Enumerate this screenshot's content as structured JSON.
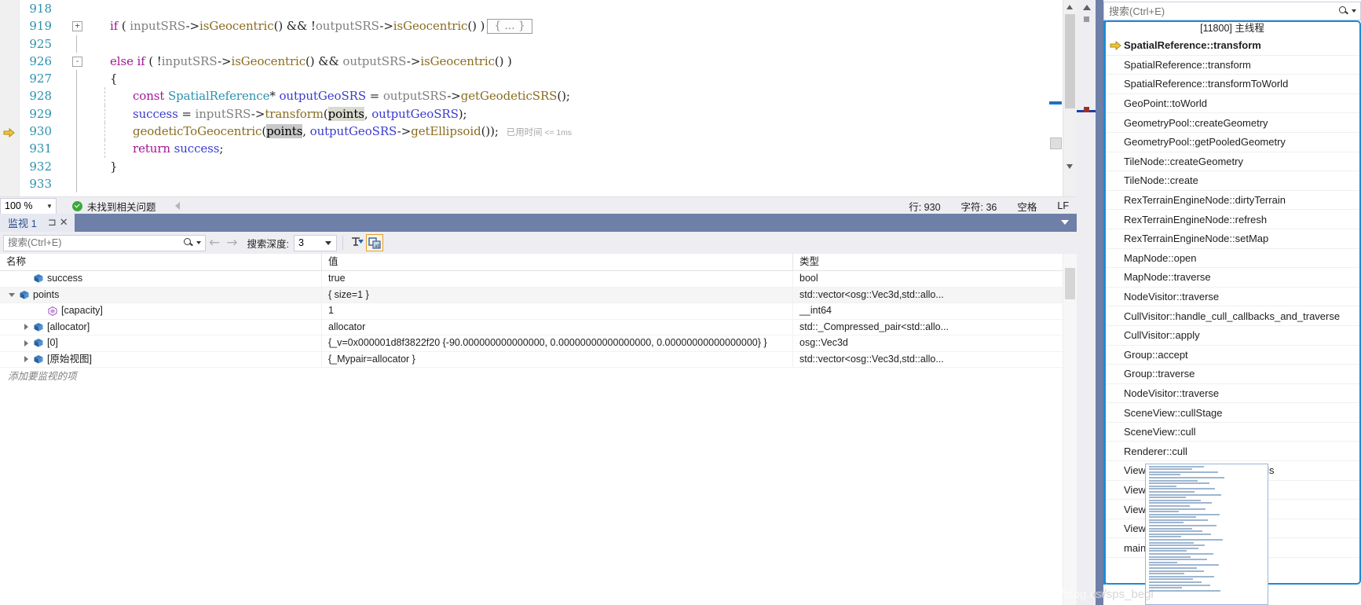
{
  "editor": {
    "lines": [
      {
        "num": "918",
        "fold": "",
        "indent": 0,
        "tokens": []
      },
      {
        "num": "919",
        "fold": "+",
        "indent": 0,
        "tokens": [
          {
            "t": "kw",
            "s": "if"
          },
          {
            "t": "pln",
            "s": " ( "
          },
          {
            "t": "gray",
            "s": "inputSRS"
          },
          {
            "t": "pln",
            "s": "->"
          },
          {
            "t": "fn",
            "s": "isGeocentric"
          },
          {
            "t": "pln",
            "s": "() && !"
          },
          {
            "t": "gray",
            "s": "outputSRS"
          },
          {
            "t": "pln",
            "s": "->"
          },
          {
            "t": "fn",
            "s": "isGeocentric"
          },
          {
            "t": "pln",
            "s": "() )"
          },
          {
            "t": "collapsed",
            "s": "{ ... }"
          }
        ]
      },
      {
        "num": "925",
        "fold": "",
        "indent": 0,
        "tokens": []
      },
      {
        "num": "926",
        "fold": "-",
        "indent": 0,
        "tokens": [
          {
            "t": "kw",
            "s": "else"
          },
          {
            "t": "pln",
            "s": " "
          },
          {
            "t": "kw",
            "s": "if"
          },
          {
            "t": "pln",
            "s": " ( !"
          },
          {
            "t": "gray",
            "s": "inputSRS"
          },
          {
            "t": "pln",
            "s": "->"
          },
          {
            "t": "fn",
            "s": "isGeocentric"
          },
          {
            "t": "pln",
            "s": "() && "
          },
          {
            "t": "gray",
            "s": "outputSRS"
          },
          {
            "t": "pln",
            "s": "->"
          },
          {
            "t": "fn",
            "s": "isGeocentric"
          },
          {
            "t": "pln",
            "s": "() )"
          }
        ]
      },
      {
        "num": "927",
        "fold": "",
        "indent": 0,
        "tokens": [
          {
            "t": "pln",
            "s": "{"
          }
        ]
      },
      {
        "num": "928",
        "fold": "",
        "indent": 1,
        "tokens": [
          {
            "t": "kw",
            "s": "const"
          },
          {
            "t": "pln",
            "s": " "
          },
          {
            "t": "typ",
            "s": "SpatialReference"
          },
          {
            "t": "pln",
            "s": "* "
          },
          {
            "t": "var",
            "s": "outputGeoSRS"
          },
          {
            "t": "pln",
            "s": " = "
          },
          {
            "t": "gray",
            "s": "outputSRS"
          },
          {
            "t": "pln",
            "s": "->"
          },
          {
            "t": "fn",
            "s": "getGeodeticSRS"
          },
          {
            "t": "pln",
            "s": "();"
          }
        ]
      },
      {
        "num": "929",
        "fold": "",
        "indent": 1,
        "tokens": [
          {
            "t": "var",
            "s": "success"
          },
          {
            "t": "pln",
            "s": " = "
          },
          {
            "t": "gray",
            "s": "inputSRS"
          },
          {
            "t": "pln",
            "s": "->"
          },
          {
            "t": "fn",
            "s": "transform"
          },
          {
            "t": "pln",
            "s": "("
          },
          {
            "t": "hl",
            "s": "points"
          },
          {
            "t": "pln",
            "s": ", "
          },
          {
            "t": "var",
            "s": "outputGeoSRS"
          },
          {
            "t": "pln",
            "s": ");"
          }
        ]
      },
      {
        "num": "930",
        "fold": "",
        "indent": 1,
        "current": true,
        "tokens": [
          {
            "t": "fn",
            "s": "geodeticToGeocentric"
          },
          {
            "t": "pln",
            "s": "("
          },
          {
            "t": "hl2",
            "s": "points"
          },
          {
            "t": "pln",
            "s": ", "
          },
          {
            "t": "var",
            "s": "outputGeoSRS"
          },
          {
            "t": "pln",
            "s": "->"
          },
          {
            "t": "fn",
            "s": "getEllipsoid"
          },
          {
            "t": "pln",
            "s": "());"
          },
          {
            "t": "elapsed",
            "s": "已用时间",
            "num": "<= 1ms"
          }
        ]
      },
      {
        "num": "931",
        "fold": "",
        "indent": 1,
        "tokens": [
          {
            "t": "kw",
            "s": "return"
          },
          {
            "t": "pln",
            "s": " "
          },
          {
            "t": "var",
            "s": "success"
          },
          {
            "t": "pln",
            "s": ";"
          }
        ]
      },
      {
        "num": "932",
        "fold": "",
        "indent": 0,
        "tokens": [
          {
            "t": "pln",
            "s": "}"
          }
        ]
      },
      {
        "num": "933",
        "fold": "",
        "indent": 0,
        "tokens": []
      }
    ]
  },
  "editor_status": {
    "zoom": "100 %",
    "problems": "未找到相关问题",
    "line_label": "行: 930",
    "char_label": "字符: 36",
    "spaces_label": "空格",
    "eol_label": "LF"
  },
  "watch": {
    "tab_title": "监视 1",
    "pin_icon": "pin-icon",
    "close_icon": "close-icon",
    "search_placeholder": "搜索(Ctrl+E)",
    "search_value": "",
    "depth_label": "搜索深度:",
    "depth_value": "3",
    "back_icon": "arrow-left-icon",
    "forward_icon": "arrow-right-icon",
    "filter_icon": "filter-pin-icon",
    "hex_icon": "hex-display-icon",
    "columns": [
      "名称",
      "值",
      "类型"
    ],
    "rows": [
      {
        "indent": 1,
        "expander": "none",
        "glyph": "field-cube",
        "name": "success",
        "value": "true",
        "type": "bool"
      },
      {
        "indent": 0,
        "expander": "expanded",
        "glyph": "field-cube",
        "name": "points",
        "value": "{ size=1 }",
        "type": "std::vector<osg::Vec3d,std::allo..."
      },
      {
        "indent": 2,
        "expander": "none",
        "glyph": "property",
        "name": "[capacity]",
        "value": "1",
        "type": "__int64"
      },
      {
        "indent": 1,
        "expander": "collapsed",
        "glyph": "field-cube",
        "name": "[allocator]",
        "value": "allocator",
        "type": "std::_Compressed_pair<std::allo..."
      },
      {
        "indent": 1,
        "expander": "collapsed",
        "glyph": "field-cube",
        "name": "[0]",
        "value": "{_v=0x000001d8f3822f20 {-90.000000000000000, 0.00000000000000000, 0.00000000000000000} }",
        "type": "osg::Vec3d"
      },
      {
        "indent": 1,
        "expander": "collapsed",
        "glyph": "field-cube",
        "name": "[原始视图]",
        "value": "{_Mypair=allocator }",
        "type": "std::vector<osg::Vec3d,std::allo..."
      }
    ],
    "add_watch_text": "添加要监视的项"
  },
  "callstack": {
    "search_placeholder": "搜索(Ctrl+E)",
    "search_value": "",
    "thread_header": "[11800] 主线程",
    "frames": [
      {
        "label": "SpatialReference::transform",
        "current": true
      },
      {
        "label": "SpatialReference::transform",
        "current": false
      },
      {
        "label": "SpatialReference::transformToWorld",
        "current": false
      },
      {
        "label": "GeoPoint::toWorld",
        "current": false
      },
      {
        "label": "GeometryPool::createGeometry",
        "current": false
      },
      {
        "label": "GeometryPool::getPooledGeometry",
        "current": false
      },
      {
        "label": "TileNode::createGeometry",
        "current": false
      },
      {
        "label": "TileNode::create",
        "current": false
      },
      {
        "label": "RexTerrainEngineNode::dirtyTerrain",
        "current": false
      },
      {
        "label": "RexTerrainEngineNode::refresh",
        "current": false
      },
      {
        "label": "RexTerrainEngineNode::setMap",
        "current": false
      },
      {
        "label": "MapNode::open",
        "current": false
      },
      {
        "label": "MapNode::traverse",
        "current": false
      },
      {
        "label": "NodeVisitor::traverse",
        "current": false
      },
      {
        "label": "CullVisitor::handle_cull_callbacks_and_traverse",
        "current": false
      },
      {
        "label": "CullVisitor::apply",
        "current": false
      },
      {
        "label": "Group::accept",
        "current": false
      },
      {
        "label": "Group::traverse",
        "current": false
      },
      {
        "label": "NodeVisitor::traverse",
        "current": false
      },
      {
        "label": "SceneView::cullStage",
        "current": false
      },
      {
        "label": "SceneView::cull",
        "current": false
      },
      {
        "label": "Renderer::cull",
        "current": false
      },
      {
        "label": "ViewerBase::renderingTraversals",
        "current": false
      },
      {
        "label": "ViewerBase::frame",
        "current": false
      },
      {
        "label": "ViewerBase::run",
        "current": false
      },
      {
        "label": "Viewer::run",
        "current": false
      },
      {
        "label": "main",
        "current": false
      }
    ]
  },
  "watermark": {
    "text": "https://blog.csdn.n",
    "text2": "et/sps_begi"
  },
  "colors": {
    "accent_blue": "#1f8ad4",
    "panel_header": "#6e7fa8",
    "keyword_purple": "#a31598",
    "type_teal": "#2b91af",
    "function_gold": "#8a6d1f",
    "variable_blue": "#3b3bcf",
    "status_green": "#3ca73c",
    "current_line_arrow": "#efc33a"
  }
}
